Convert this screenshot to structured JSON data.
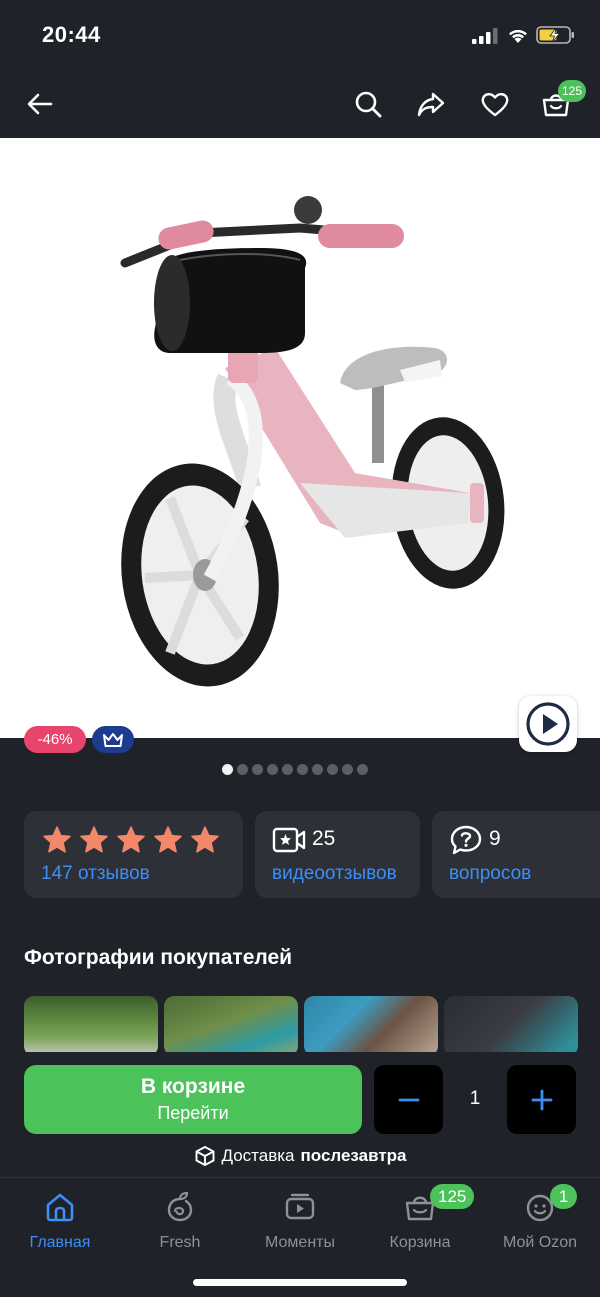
{
  "status_bar": {
    "time": "20:44"
  },
  "header": {
    "cart_badge": "125"
  },
  "product": {
    "discount_badge": "-46%",
    "carousel": {
      "total": 10,
      "active": 0
    }
  },
  "stats": {
    "rating": {
      "stars": 5,
      "reviews_label": "147 отзывов"
    },
    "videos": {
      "count": "25",
      "label": "видеоотзывов"
    },
    "questions": {
      "count": "9",
      "label": "вопросов"
    }
  },
  "customer_photos": {
    "title": "Фотографии покупателей"
  },
  "cart_action": {
    "title": "В корзине",
    "subtitle": "Перейти",
    "quantity": "1",
    "decrease_symbol": "−",
    "increase_symbol": "+"
  },
  "delivery": {
    "prefix": "Доставка",
    "date": "послезавтра"
  },
  "tab_bar": {
    "items": [
      {
        "label": "Главная",
        "icon": "home-icon",
        "active": true
      },
      {
        "label": "Fresh",
        "icon": "fresh-icon"
      },
      {
        "label": "Моменты",
        "icon": "moments-icon"
      },
      {
        "label": "Корзина",
        "icon": "cart-icon",
        "badge": "125"
      },
      {
        "label": "Мой Ozon",
        "icon": "profile-icon",
        "badge": "1"
      }
    ]
  },
  "colors": {
    "background": "#1f2228",
    "card": "#2d3037",
    "accent_blue": "#3d8ef7",
    "green": "#4bc25a",
    "discount_pink": "#e8456d",
    "star": "#f2876a"
  }
}
